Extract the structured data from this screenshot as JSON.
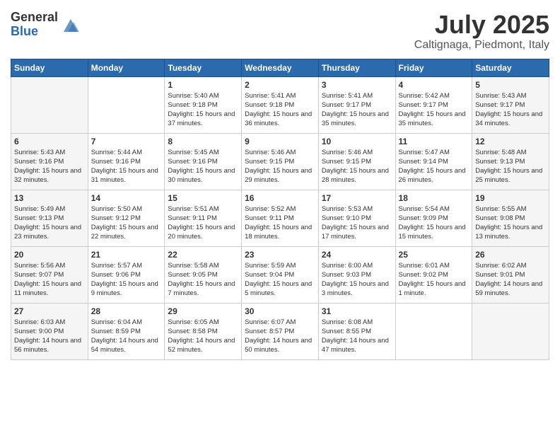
{
  "header": {
    "logo_general": "General",
    "logo_blue": "Blue",
    "month_year": "July 2025",
    "location": "Caltignaga, Piedmont, Italy"
  },
  "days_of_week": [
    "Sunday",
    "Monday",
    "Tuesday",
    "Wednesday",
    "Thursday",
    "Friday",
    "Saturday"
  ],
  "weeks": [
    [
      {
        "day": "",
        "info": ""
      },
      {
        "day": "",
        "info": ""
      },
      {
        "day": "1",
        "info": "Sunrise: 5:40 AM\nSunset: 9:18 PM\nDaylight: 15 hours\nand 37 minutes."
      },
      {
        "day": "2",
        "info": "Sunrise: 5:41 AM\nSunset: 9:18 PM\nDaylight: 15 hours\nand 36 minutes."
      },
      {
        "day": "3",
        "info": "Sunrise: 5:41 AM\nSunset: 9:17 PM\nDaylight: 15 hours\nand 35 minutes."
      },
      {
        "day": "4",
        "info": "Sunrise: 5:42 AM\nSunset: 9:17 PM\nDaylight: 15 hours\nand 35 minutes."
      },
      {
        "day": "5",
        "info": "Sunrise: 5:43 AM\nSunset: 9:17 PM\nDaylight: 15 hours\nand 34 minutes."
      }
    ],
    [
      {
        "day": "6",
        "info": "Sunrise: 5:43 AM\nSunset: 9:16 PM\nDaylight: 15 hours\nand 32 minutes."
      },
      {
        "day": "7",
        "info": "Sunrise: 5:44 AM\nSunset: 9:16 PM\nDaylight: 15 hours\nand 31 minutes."
      },
      {
        "day": "8",
        "info": "Sunrise: 5:45 AM\nSunset: 9:16 PM\nDaylight: 15 hours\nand 30 minutes."
      },
      {
        "day": "9",
        "info": "Sunrise: 5:46 AM\nSunset: 9:15 PM\nDaylight: 15 hours\nand 29 minutes."
      },
      {
        "day": "10",
        "info": "Sunrise: 5:46 AM\nSunset: 9:15 PM\nDaylight: 15 hours\nand 28 minutes."
      },
      {
        "day": "11",
        "info": "Sunrise: 5:47 AM\nSunset: 9:14 PM\nDaylight: 15 hours\nand 26 minutes."
      },
      {
        "day": "12",
        "info": "Sunrise: 5:48 AM\nSunset: 9:13 PM\nDaylight: 15 hours\nand 25 minutes."
      }
    ],
    [
      {
        "day": "13",
        "info": "Sunrise: 5:49 AM\nSunset: 9:13 PM\nDaylight: 15 hours\nand 23 minutes."
      },
      {
        "day": "14",
        "info": "Sunrise: 5:50 AM\nSunset: 9:12 PM\nDaylight: 15 hours\nand 22 minutes."
      },
      {
        "day": "15",
        "info": "Sunrise: 5:51 AM\nSunset: 9:11 PM\nDaylight: 15 hours\nand 20 minutes."
      },
      {
        "day": "16",
        "info": "Sunrise: 5:52 AM\nSunset: 9:11 PM\nDaylight: 15 hours\nand 18 minutes."
      },
      {
        "day": "17",
        "info": "Sunrise: 5:53 AM\nSunset: 9:10 PM\nDaylight: 15 hours\nand 17 minutes."
      },
      {
        "day": "18",
        "info": "Sunrise: 5:54 AM\nSunset: 9:09 PM\nDaylight: 15 hours\nand 15 minutes."
      },
      {
        "day": "19",
        "info": "Sunrise: 5:55 AM\nSunset: 9:08 PM\nDaylight: 15 hours\nand 13 minutes."
      }
    ],
    [
      {
        "day": "20",
        "info": "Sunrise: 5:56 AM\nSunset: 9:07 PM\nDaylight: 15 hours\nand 11 minutes."
      },
      {
        "day": "21",
        "info": "Sunrise: 5:57 AM\nSunset: 9:06 PM\nDaylight: 15 hours\nand 9 minutes."
      },
      {
        "day": "22",
        "info": "Sunrise: 5:58 AM\nSunset: 9:05 PM\nDaylight: 15 hours\nand 7 minutes."
      },
      {
        "day": "23",
        "info": "Sunrise: 5:59 AM\nSunset: 9:04 PM\nDaylight: 15 hours\nand 5 minutes."
      },
      {
        "day": "24",
        "info": "Sunrise: 6:00 AM\nSunset: 9:03 PM\nDaylight: 15 hours\nand 3 minutes."
      },
      {
        "day": "25",
        "info": "Sunrise: 6:01 AM\nSunset: 9:02 PM\nDaylight: 15 hours\nand 1 minute."
      },
      {
        "day": "26",
        "info": "Sunrise: 6:02 AM\nSunset: 9:01 PM\nDaylight: 14 hours\nand 59 minutes."
      }
    ],
    [
      {
        "day": "27",
        "info": "Sunrise: 6:03 AM\nSunset: 9:00 PM\nDaylight: 14 hours\nand 56 minutes."
      },
      {
        "day": "28",
        "info": "Sunrise: 6:04 AM\nSunset: 8:59 PM\nDaylight: 14 hours\nand 54 minutes."
      },
      {
        "day": "29",
        "info": "Sunrise: 6:05 AM\nSunset: 8:58 PM\nDaylight: 14 hours\nand 52 minutes."
      },
      {
        "day": "30",
        "info": "Sunrise: 6:07 AM\nSunset: 8:57 PM\nDaylight: 14 hours\nand 50 minutes."
      },
      {
        "day": "31",
        "info": "Sunrise: 6:08 AM\nSunset: 8:55 PM\nDaylight: 14 hours\nand 47 minutes."
      },
      {
        "day": "",
        "info": ""
      },
      {
        "day": "",
        "info": ""
      }
    ]
  ]
}
